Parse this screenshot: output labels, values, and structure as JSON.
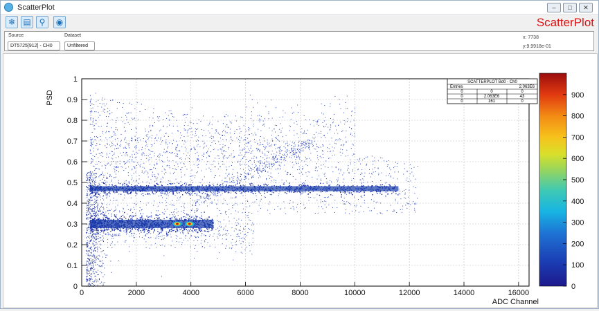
{
  "window": {
    "title": "ScatterPlot",
    "brand": "ScatterPlot",
    "icon": "app-icon"
  },
  "window_controls": {
    "minimize": "–",
    "restore": "□",
    "close": "✕"
  },
  "toolbar": {
    "buttons": [
      {
        "name": "snowflake-icon",
        "glyph": "❄"
      },
      {
        "name": "folder-icon",
        "glyph": "▤"
      },
      {
        "name": "zoom-icon",
        "glyph": "⚲"
      },
      {
        "name": "camera-icon",
        "glyph": "◉"
      }
    ]
  },
  "controls": {
    "source_label": "Source",
    "source_value": "DT5725[912] - CH0",
    "dataset_label": "Dataset",
    "dataset_value": "Unfiltered",
    "coord_x": "x: 7738",
    "coord_y": "y:9.9918e-01"
  },
  "chart_data": {
    "type": "heatmap",
    "xlabel": "ADC Channel",
    "ylabel": "PSD",
    "xlim": [
      0,
      16384
    ],
    "ylim": [
      0,
      1
    ],
    "x_ticks": [
      0,
      2000,
      4000,
      6000,
      8000,
      10000,
      12000,
      14000,
      16000
    ],
    "y_ticks": [
      0,
      0.1,
      0.2,
      0.3,
      0.4,
      0.5,
      0.6,
      0.7,
      0.8,
      0.9,
      1
    ],
    "grid": true,
    "colorbar": {
      "min": 0,
      "max": 1000,
      "ticks": [
        0,
        100,
        200,
        300,
        400,
        500,
        600,
        700,
        800,
        900
      ]
    },
    "bands": [
      {
        "name": "",
        "x_start": 300,
        "x_end": 11600,
        "psd": 0.47,
        "spread": 0.012
      },
      {
        "name": "",
        "x_start": 300,
        "x_end": 4800,
        "psd": 0.3,
        "spread": 0.02
      }
    ],
    "hotspots": [
      {
        "x": 3500,
        "y": 0.3
      },
      {
        "x": 3950,
        "y": 0.3
      }
    ],
    "stats": {
      "title": "SCATTERPLOT Bd0 - Ch0",
      "entries_label": "Entries",
      "entries_value": "2.063E6",
      "rows": [
        [
          "0",
          "0",
          "0"
        ],
        [
          "0",
          "2.063E6",
          "43"
        ],
        [
          "0",
          "161",
          "0"
        ]
      ]
    }
  }
}
